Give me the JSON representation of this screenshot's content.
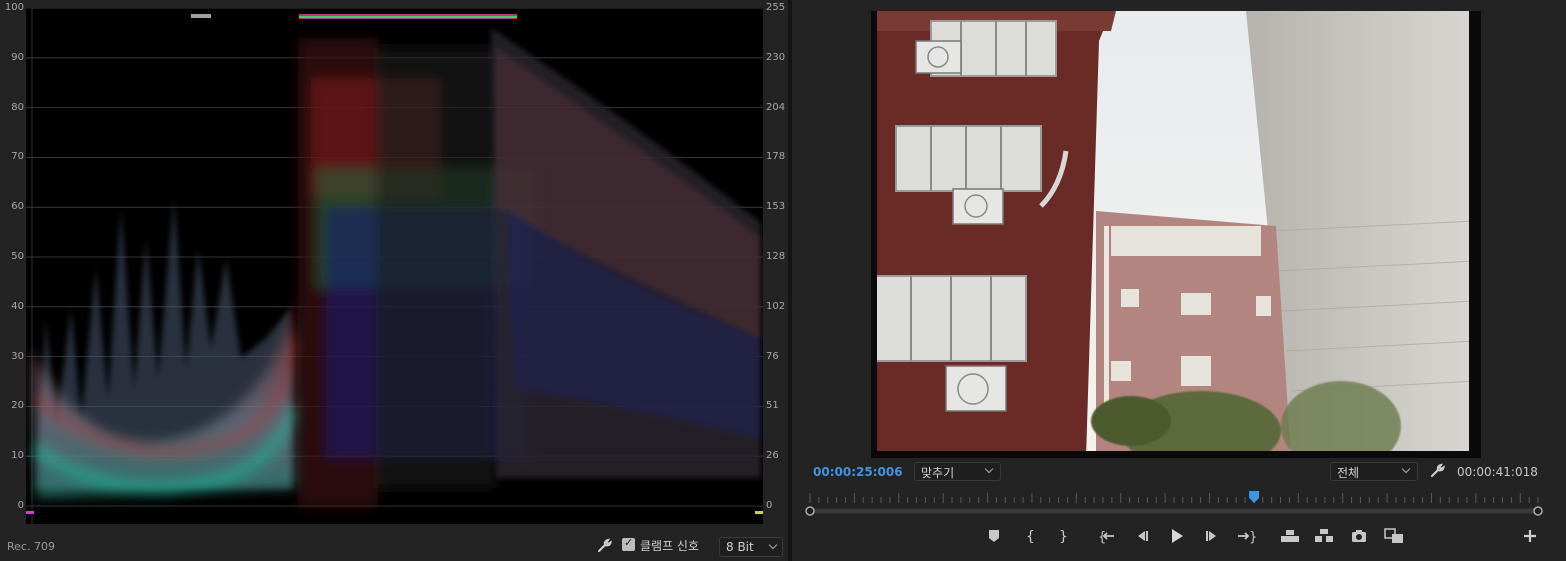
{
  "scope": {
    "standard": "Rec. 709",
    "clamp_label": "클램프 신호",
    "clamp_checked": true,
    "bit_depth": "8 Bit",
    "left_axis": [
      "100",
      "90",
      "80",
      "70",
      "60",
      "50",
      "40",
      "30",
      "20",
      "10",
      "0"
    ],
    "right_axis": [
      "255",
      "230",
      "204",
      "178",
      "153",
      "128",
      "102",
      "76",
      "51",
      "26",
      "0"
    ]
  },
  "monitor": {
    "current_timecode": "00:00:25:006",
    "zoom_fit": "맞추기",
    "resolution": "전체",
    "duration_timecode": "00:00:41:018",
    "playhead_fraction": 0.61
  },
  "transport": {
    "buttons": [
      "marker-icon",
      "mark-in-icon",
      "mark-out-icon",
      "go-to-in-icon",
      "step-back-icon",
      "play-icon",
      "step-forward-icon",
      "go-to-out-icon",
      "lift-icon",
      "extract-icon",
      "camera-icon",
      "compare-icon",
      "add-icon"
    ]
  },
  "colors": {
    "accent_blue": "#3d96e4",
    "panel_bg": "#232323"
  }
}
